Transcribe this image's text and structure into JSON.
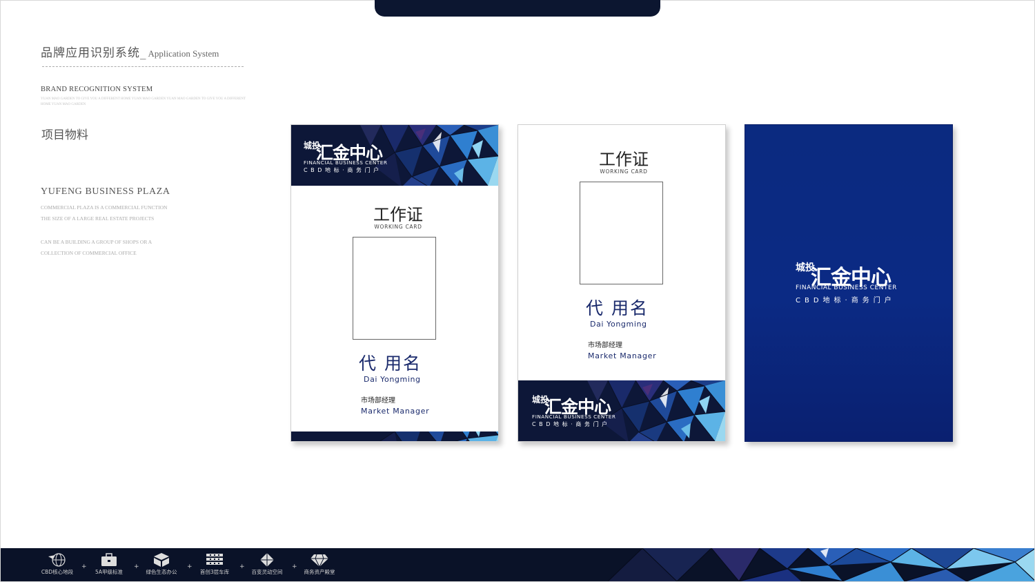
{
  "header": {
    "title_cn": "品牌应用识别系统_",
    "title_en": "Application  System",
    "brand_heading": "BRAND RECOGNITION SYSTEM",
    "brand_sub": "YUAN MAO GARDEN TO GIVE YOU A DIFFERENT HOME YUAN MAO GARDEN YUAN MAO GARDEN TO GIVE YOU A DIFFERENT HOME YUAN MAO GARDEN",
    "section": "项目物料",
    "plaza": "YUFENG  BUSINESS  PLAZA",
    "para1": [
      "COMMERCIAL PLAZA IS A COMMERCIAL FUNCTION",
      "THE SIZE OF A LARGE REAL ESTATE PROJECTS"
    ],
    "para2": [
      "CAN BE A BUILDING A GROUP OF SHOPS OR A",
      "COLLECTION OF COMMERCIAL OFFICE"
    ]
  },
  "logo": {
    "prefix": "城投",
    "name": "汇金中心",
    "en": "FINANCIAL BUSINESS CENTER",
    "tagline": "CBD地标·商务门户"
  },
  "badge": {
    "title": "工作证",
    "subtitle": "WORKING CARD",
    "name_cn": "代 用名",
    "name_en": "Dai Yongming",
    "position_cn": "市场部经理",
    "position_en": "Market Manager"
  },
  "footer": {
    "items": [
      {
        "label": "CBD核心地段",
        "icon": "globe-icon"
      },
      {
        "label": "5A甲级标准",
        "icon": "briefcase-icon"
      },
      {
        "label": "绿色生态办公",
        "icon": "leaf-cube-icon"
      },
      {
        "label": "首创3层车库",
        "icon": "building-icon"
      },
      {
        "label": "百变灵动空间",
        "icon": "diamond-shape-icon"
      },
      {
        "label": "商务资产殿堂",
        "icon": "gem-icon"
      }
    ],
    "separator": "+"
  },
  "colors": {
    "navy": "#0b2a80",
    "dark": "#0a1228",
    "accent": "#3a8fd6"
  }
}
